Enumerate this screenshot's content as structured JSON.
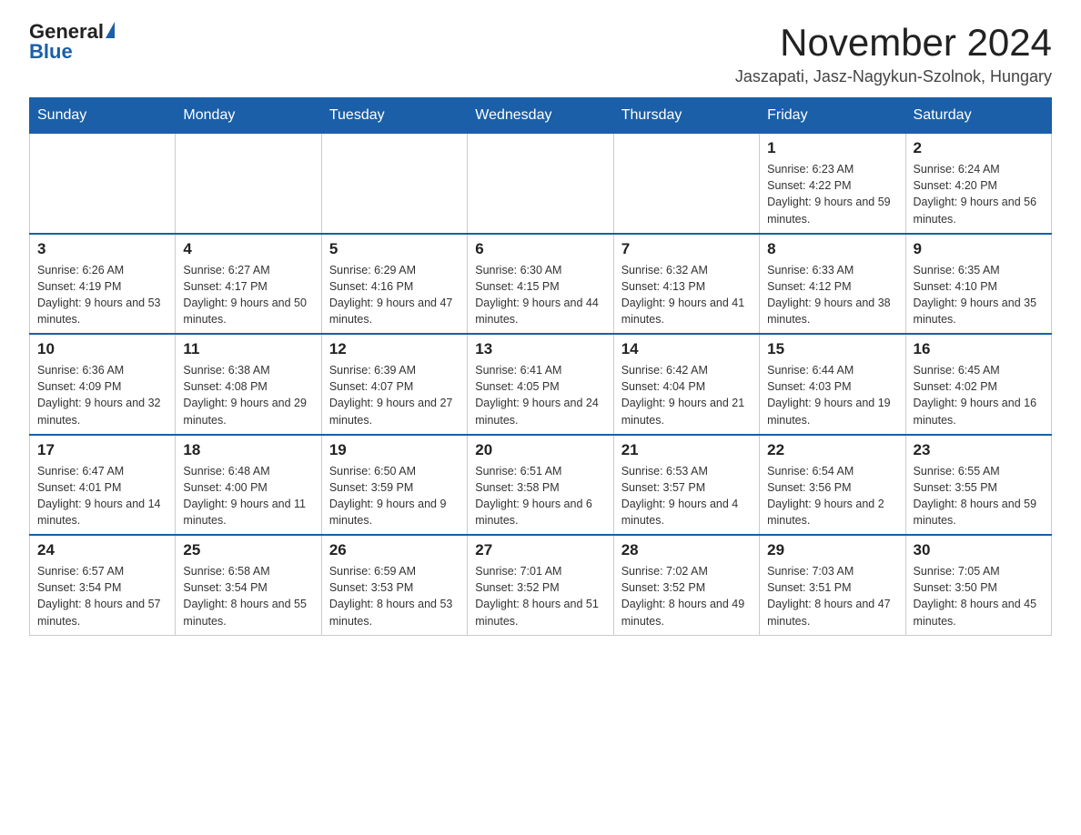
{
  "logo": {
    "general": "General",
    "blue": "Blue"
  },
  "header": {
    "month": "November 2024",
    "location": "Jaszapati, Jasz-Nagykun-Szolnok, Hungary"
  },
  "weekdays": [
    "Sunday",
    "Monday",
    "Tuesday",
    "Wednesday",
    "Thursday",
    "Friday",
    "Saturday"
  ],
  "weeks": [
    {
      "days": [
        {
          "number": "",
          "info": ""
        },
        {
          "number": "",
          "info": ""
        },
        {
          "number": "",
          "info": ""
        },
        {
          "number": "",
          "info": ""
        },
        {
          "number": "",
          "info": ""
        },
        {
          "number": "1",
          "info": "Sunrise: 6:23 AM\nSunset: 4:22 PM\nDaylight: 9 hours and 59 minutes."
        },
        {
          "number": "2",
          "info": "Sunrise: 6:24 AM\nSunset: 4:20 PM\nDaylight: 9 hours and 56 minutes."
        }
      ]
    },
    {
      "days": [
        {
          "number": "3",
          "info": "Sunrise: 6:26 AM\nSunset: 4:19 PM\nDaylight: 9 hours and 53 minutes."
        },
        {
          "number": "4",
          "info": "Sunrise: 6:27 AM\nSunset: 4:17 PM\nDaylight: 9 hours and 50 minutes."
        },
        {
          "number": "5",
          "info": "Sunrise: 6:29 AM\nSunset: 4:16 PM\nDaylight: 9 hours and 47 minutes."
        },
        {
          "number": "6",
          "info": "Sunrise: 6:30 AM\nSunset: 4:15 PM\nDaylight: 9 hours and 44 minutes."
        },
        {
          "number": "7",
          "info": "Sunrise: 6:32 AM\nSunset: 4:13 PM\nDaylight: 9 hours and 41 minutes."
        },
        {
          "number": "8",
          "info": "Sunrise: 6:33 AM\nSunset: 4:12 PM\nDaylight: 9 hours and 38 minutes."
        },
        {
          "number": "9",
          "info": "Sunrise: 6:35 AM\nSunset: 4:10 PM\nDaylight: 9 hours and 35 minutes."
        }
      ]
    },
    {
      "days": [
        {
          "number": "10",
          "info": "Sunrise: 6:36 AM\nSunset: 4:09 PM\nDaylight: 9 hours and 32 minutes."
        },
        {
          "number": "11",
          "info": "Sunrise: 6:38 AM\nSunset: 4:08 PM\nDaylight: 9 hours and 29 minutes."
        },
        {
          "number": "12",
          "info": "Sunrise: 6:39 AM\nSunset: 4:07 PM\nDaylight: 9 hours and 27 minutes."
        },
        {
          "number": "13",
          "info": "Sunrise: 6:41 AM\nSunset: 4:05 PM\nDaylight: 9 hours and 24 minutes."
        },
        {
          "number": "14",
          "info": "Sunrise: 6:42 AM\nSunset: 4:04 PM\nDaylight: 9 hours and 21 minutes."
        },
        {
          "number": "15",
          "info": "Sunrise: 6:44 AM\nSunset: 4:03 PM\nDaylight: 9 hours and 19 minutes."
        },
        {
          "number": "16",
          "info": "Sunrise: 6:45 AM\nSunset: 4:02 PM\nDaylight: 9 hours and 16 minutes."
        }
      ]
    },
    {
      "days": [
        {
          "number": "17",
          "info": "Sunrise: 6:47 AM\nSunset: 4:01 PM\nDaylight: 9 hours and 14 minutes."
        },
        {
          "number": "18",
          "info": "Sunrise: 6:48 AM\nSunset: 4:00 PM\nDaylight: 9 hours and 11 minutes."
        },
        {
          "number": "19",
          "info": "Sunrise: 6:50 AM\nSunset: 3:59 PM\nDaylight: 9 hours and 9 minutes."
        },
        {
          "number": "20",
          "info": "Sunrise: 6:51 AM\nSunset: 3:58 PM\nDaylight: 9 hours and 6 minutes."
        },
        {
          "number": "21",
          "info": "Sunrise: 6:53 AM\nSunset: 3:57 PM\nDaylight: 9 hours and 4 minutes."
        },
        {
          "number": "22",
          "info": "Sunrise: 6:54 AM\nSunset: 3:56 PM\nDaylight: 9 hours and 2 minutes."
        },
        {
          "number": "23",
          "info": "Sunrise: 6:55 AM\nSunset: 3:55 PM\nDaylight: 8 hours and 59 minutes."
        }
      ]
    },
    {
      "days": [
        {
          "number": "24",
          "info": "Sunrise: 6:57 AM\nSunset: 3:54 PM\nDaylight: 8 hours and 57 minutes."
        },
        {
          "number": "25",
          "info": "Sunrise: 6:58 AM\nSunset: 3:54 PM\nDaylight: 8 hours and 55 minutes."
        },
        {
          "number": "26",
          "info": "Sunrise: 6:59 AM\nSunset: 3:53 PM\nDaylight: 8 hours and 53 minutes."
        },
        {
          "number": "27",
          "info": "Sunrise: 7:01 AM\nSunset: 3:52 PM\nDaylight: 8 hours and 51 minutes."
        },
        {
          "number": "28",
          "info": "Sunrise: 7:02 AM\nSunset: 3:52 PM\nDaylight: 8 hours and 49 minutes."
        },
        {
          "number": "29",
          "info": "Sunrise: 7:03 AM\nSunset: 3:51 PM\nDaylight: 8 hours and 47 minutes."
        },
        {
          "number": "30",
          "info": "Sunrise: 7:05 AM\nSunset: 3:50 PM\nDaylight: 8 hours and 45 minutes."
        }
      ]
    }
  ]
}
